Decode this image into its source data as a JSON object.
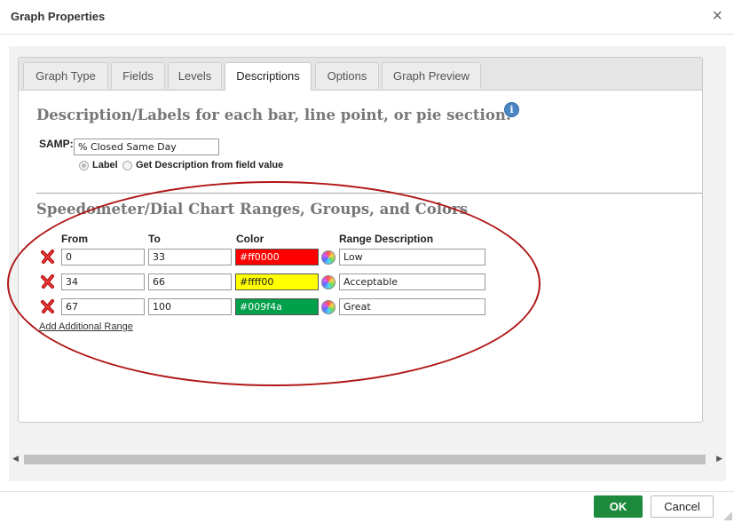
{
  "dialog": {
    "title": "Graph Properties",
    "close_glyph": "×"
  },
  "tabs": [
    {
      "label": "Graph Type"
    },
    {
      "label": "Fields"
    },
    {
      "label": "Levels"
    },
    {
      "label": "Descriptions",
      "active": true
    },
    {
      "label": "Options"
    },
    {
      "label": "Graph Preview"
    }
  ],
  "descriptions": {
    "heading": "Description/Labels for each bar, line point, or pie section:",
    "info_glyph": "i",
    "field_label": "SAMP:",
    "field_value": "% Closed Same Day",
    "radio_label": "Label",
    "radio_field_value": "Get Description from field value",
    "selected_option": "Label"
  },
  "ranges": {
    "heading": "Speedometer/Dial Chart Ranges, Groups, and Colors",
    "headers": {
      "from": "From",
      "to": "To",
      "color": "Color",
      "desc": "Range Description"
    },
    "rows": [
      {
        "from": "0",
        "to": "33",
        "color": "#ff0000",
        "text_color": "#ffffff",
        "desc": "Low"
      },
      {
        "from": "34",
        "to": "66",
        "color": "#ffff00",
        "text_color": "#222222",
        "desc": "Acceptable"
      },
      {
        "from": "67",
        "to": "100",
        "color": "#009f4a",
        "text_color": "#ffffff",
        "desc": "Great"
      }
    ],
    "add_link": "Add Additional Range"
  },
  "scrollbar": {
    "left_arrow": "◀",
    "right_arrow": "▶"
  },
  "footer": {
    "ok": "OK",
    "cancel": "Cancel"
  },
  "theme": {
    "ok_color": "#1e8a3e",
    "annotation_color": "#b01616"
  }
}
